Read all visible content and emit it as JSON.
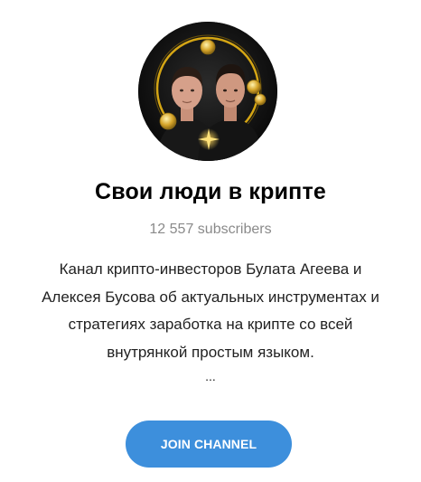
{
  "channel": {
    "title": "Свои люди в крипте",
    "subscribers": "12 557 subscribers",
    "description_lines": [
      "Канал крипто-инвесторов Булата Агеева и",
      "Алексея Бусова об актуальных инструментах и",
      "стратегиях заработка на крипте со всей",
      "внутрянкой простым языком."
    ],
    "ellipsis": "...",
    "avatar_icon": "channel-avatar-photo"
  },
  "actions": {
    "join_label": "JOIN CHANNEL"
  },
  "colors": {
    "button": "#3d8fdc",
    "subscribers_text": "#8a8a8a",
    "avatar_ring": "#d4a514"
  }
}
